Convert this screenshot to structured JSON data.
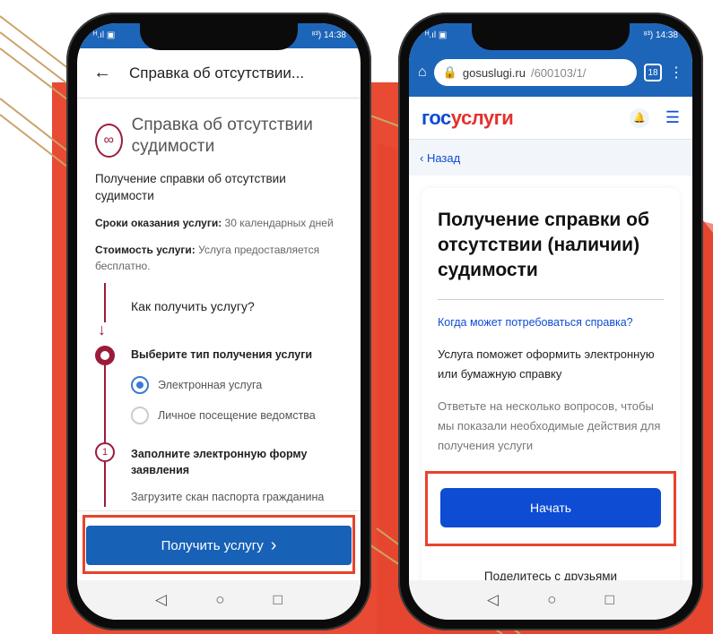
{
  "left": {
    "status": {
      "left": "ᴴ.ıl ▣",
      "right": "⁸³) 14:38"
    },
    "header": {
      "title": "Справка об отсутствии...",
      "back": "←"
    },
    "service_title": "Справка об отсутствии судимости",
    "intro": "Получение справки об отсутствии судимости",
    "term_label": "Сроки оказания услуги:",
    "term_value": " 30 календарных дней",
    "cost_label": "Стоимость услуги:",
    "cost_value": " Услуга предоставляется бесплатно.",
    "how_question": "Как получить услугу?",
    "step1_title": "Выберите тип получения услуги",
    "radio_options": [
      "Электронная услуга",
      "Личное посещение ведомства"
    ],
    "step2_number": "1",
    "step2_title": "Заполните электронную форму заявления",
    "step2_sub": "Загрузите скан паспорта гражданина",
    "button": "Получить услугу",
    "button_chevron": "›"
  },
  "right": {
    "status": {
      "left": "ᴴ.ıl ▣",
      "right": "⁸³) 14:38"
    },
    "url": {
      "host": "gosuslugi.ru",
      "path": "/600103/1/"
    },
    "tabs_count": "18",
    "logo": {
      "part1": "гос",
      "part2": "услуги"
    },
    "back_link": "‹ Назад",
    "card_title": "Получение справки об отсутствии (наличии) судимости",
    "when_link": "Когда может потребоваться справка?",
    "text1": "Услуга поможет оформить электронную или бумажную справку",
    "text2": "Ответьте на несколько вопросов, чтобы мы показали необходимые действия для получения услуги",
    "start_button": "Начать",
    "share": "Поделитесь с друзьями"
  },
  "nav_icons": [
    "◁",
    "○",
    "□"
  ],
  "colors": {
    "accent_red": "#e8432b",
    "gos_blue": "#0d4cd3",
    "app_blue": "#1761b6",
    "maroon": "#9b1b3a"
  }
}
